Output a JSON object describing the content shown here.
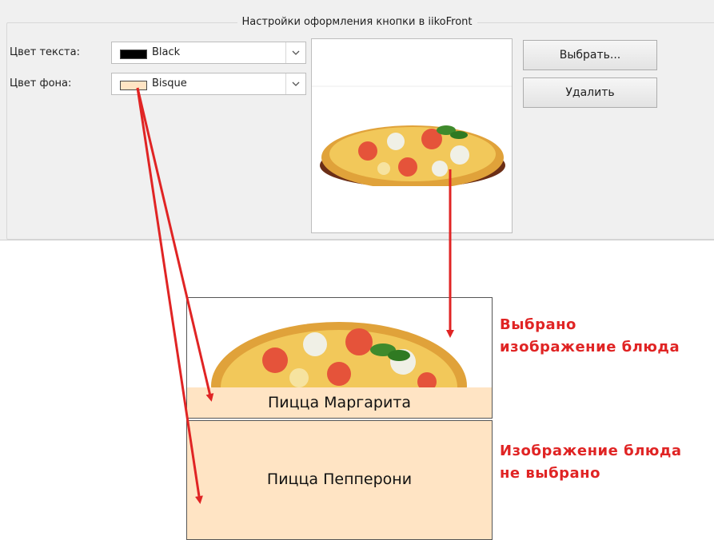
{
  "settings": {
    "group_title": "Настройки оформления кнопки в iikoFront",
    "text_color_label": "Цвет текста:",
    "text_color_value": "Black",
    "text_color_hex": "#000000",
    "bg_color_label": "Цвет фона:",
    "bg_color_value": "Bisque",
    "bg_color_hex": "#ffe4c4",
    "choose_button": "Выбрать...",
    "delete_button": "Удалить"
  },
  "preview": {
    "buttons": [
      {
        "caption": "Пицца Маргарита",
        "has_image": true
      },
      {
        "caption": "Пицца Пепперони",
        "has_image": false
      }
    ]
  },
  "annotations": {
    "image_selected": [
      "Выбрано",
      "изображение блюда"
    ],
    "image_not_selected": [
      "Изображение блюда",
      "не выбрано"
    ]
  },
  "colors": {
    "annotation": "#e02424",
    "panel": "#f0f0f0"
  },
  "icons": [
    "chevron-down-icon",
    "pizza-image"
  ]
}
